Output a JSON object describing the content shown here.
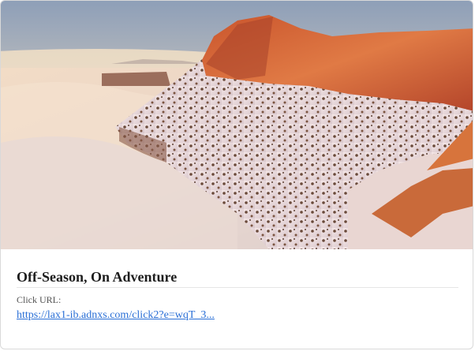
{
  "card": {
    "image": {
      "alt": "",
      "icon": "landscape-photo"
    },
    "title": "Off-Season, On Adventure",
    "url_label": "Click URL:",
    "url_text": "https://lax1-ib.adnxs.com/click2?e=wqT_3..."
  },
  "colors": {
    "link": "#2a6fd6",
    "title": "#1d1d1d",
    "label": "#555555",
    "border": "#d9d9d9"
  }
}
